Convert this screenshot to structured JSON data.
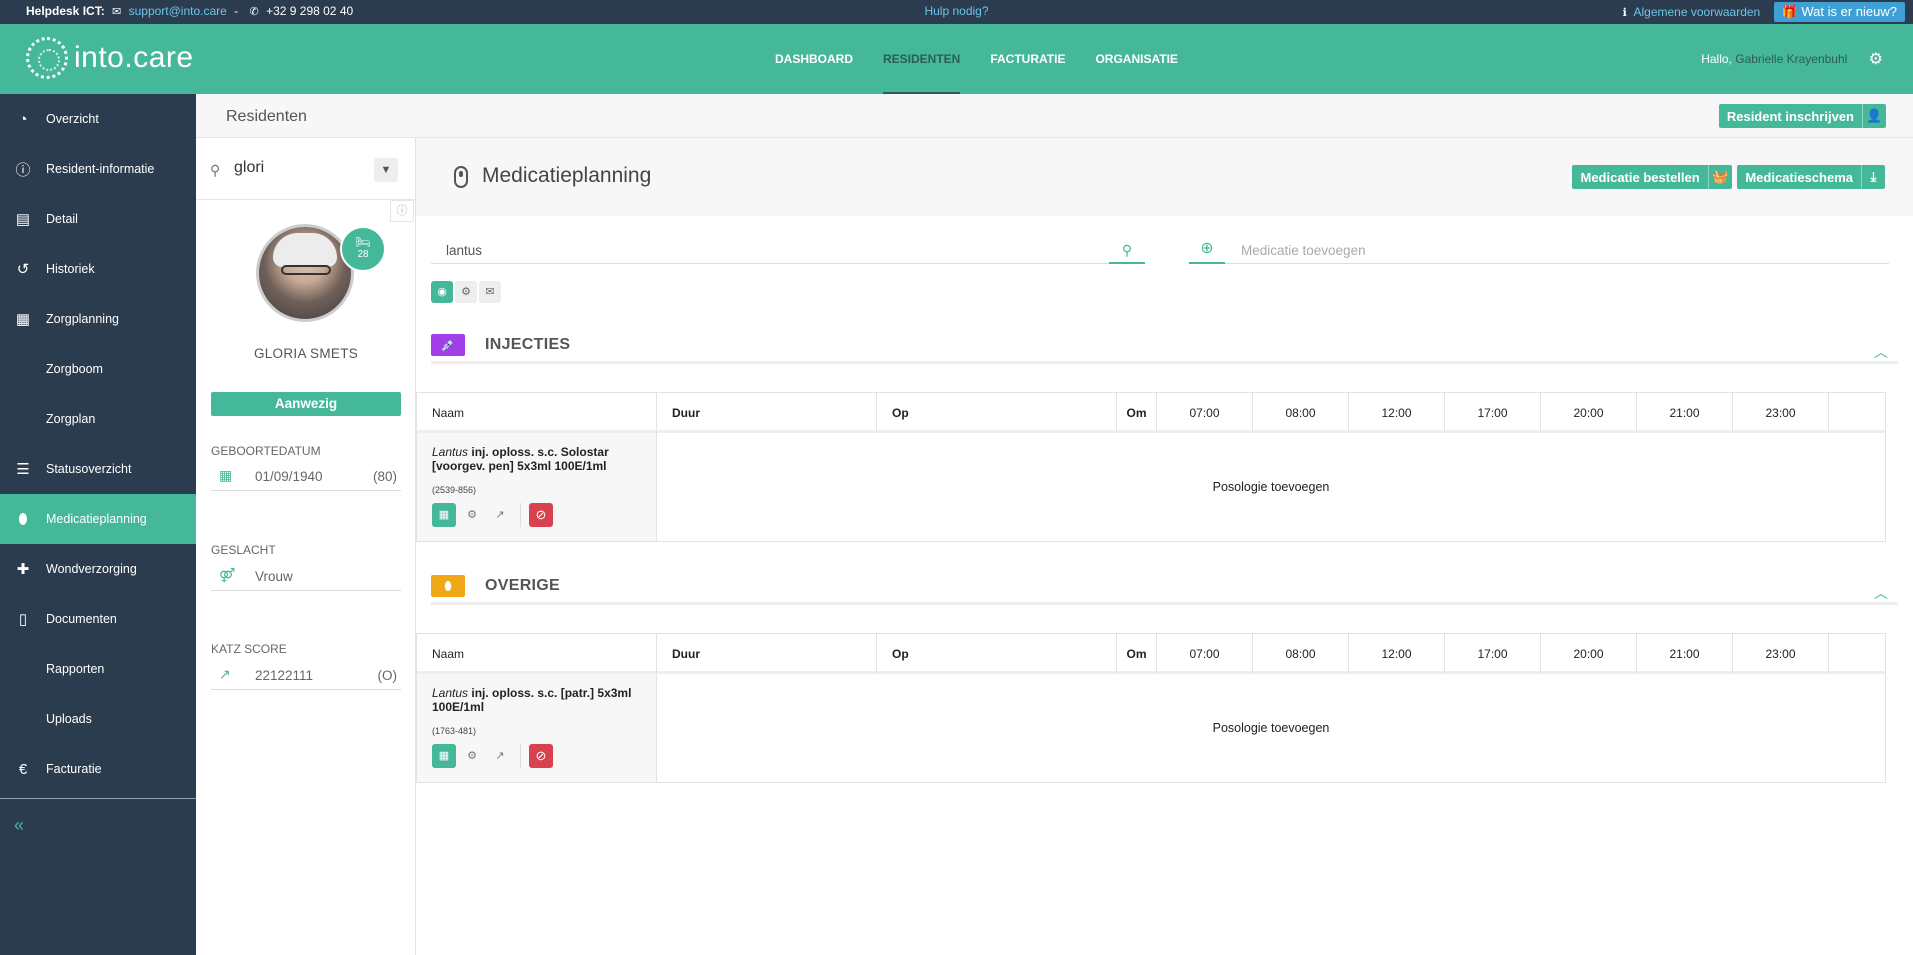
{
  "topbar": {
    "helpdesk_label": "Helpdesk ICT:",
    "email": "support@into.care",
    "separator": "-",
    "phone": "+32 9 298 02 40",
    "help": "Hulp nodig?",
    "terms": "Algemene voorwaarden",
    "news": "Wat is er nieuw?"
  },
  "header": {
    "logo_text": "into.care",
    "nav": [
      "DASHBOARD",
      "RESIDENTEN",
      "FACTURATIE",
      "ORGANISATIE"
    ],
    "active_nav": "RESIDENTEN",
    "greeting": "Hallo,",
    "user_name": "Gabrielle Krayenbuhl"
  },
  "sidebar": {
    "items": [
      {
        "label": "Overzicht",
        "icon": "dashboard-icon"
      },
      {
        "label": "Resident-informatie",
        "icon": "info-icon"
      },
      {
        "label": "Detail",
        "icon": "detail-icon"
      },
      {
        "label": "Historiek",
        "icon": "history-icon"
      },
      {
        "label": "Zorgplanning",
        "icon": "calendar-icon"
      },
      {
        "label": "Zorgboom",
        "icon": ""
      },
      {
        "label": "Zorgplan",
        "icon": ""
      },
      {
        "label": "Statusoverzicht",
        "icon": "list-icon"
      },
      {
        "label": "Medicatieplanning",
        "icon": "pill-icon"
      },
      {
        "label": "Wondverzorging",
        "icon": "medkit-icon"
      },
      {
        "label": "Documenten",
        "icon": "file-icon"
      },
      {
        "label": "Rapporten",
        "icon": ""
      },
      {
        "label": "Uploads",
        "icon": ""
      },
      {
        "label": "Facturatie",
        "icon": "euro-icon"
      }
    ],
    "active": "Medicatieplanning",
    "collapse": "«"
  },
  "subheader": {
    "title": "Residenten",
    "enroll_button": "Resident inschrijven"
  },
  "resident": {
    "search_value": "glori",
    "bed_number": "28",
    "name": "GLORIA SMETS",
    "status": "Aanwezig",
    "birth_label": "GEBOORTEDATUM",
    "birth_date": "01/09/1940",
    "age": "(80)",
    "gender_label": "GESLACHT",
    "gender": "Vrouw",
    "katz_label": "KATZ SCORE",
    "katz": "22122111",
    "katz_class": "(O)"
  },
  "main": {
    "title": "Medicatieplanning",
    "order_button": "Medicatie bestellen",
    "schema_button": "Medicatieschema",
    "search_value": "lantus",
    "add_placeholder": "Medicatie toevoegen"
  },
  "table_headers": {
    "naam": "Naam",
    "duur": "Duur",
    "op": "Op",
    "om": "Om",
    "times": [
      "07:00",
      "08:00",
      "12:00",
      "17:00",
      "20:00",
      "21:00",
      "23:00"
    ]
  },
  "sections": [
    {
      "title": "INJECTIES",
      "color": "#a23ee8",
      "rows": [
        {
          "brand": "Lantus",
          "name": " inj. oploss. s.c. Solostar [voorgev. pen] 5x3ml 100E/1ml",
          "code": "(2539-856)",
          "posology": "Posologie toevoegen"
        }
      ]
    },
    {
      "title": "OVERIGE",
      "color": "#f0a818",
      "rows": [
        {
          "brand": "Lantus",
          "name": " inj. oploss. s.c. [patr.] 5x3ml 100E/1ml",
          "code": "(1763-481)",
          "posology": "Posologie toevoegen"
        }
      ]
    }
  ],
  "colors": {
    "accent": "#46b89a",
    "sidebar": "#2b3c4e",
    "danger": "#d9414e"
  }
}
